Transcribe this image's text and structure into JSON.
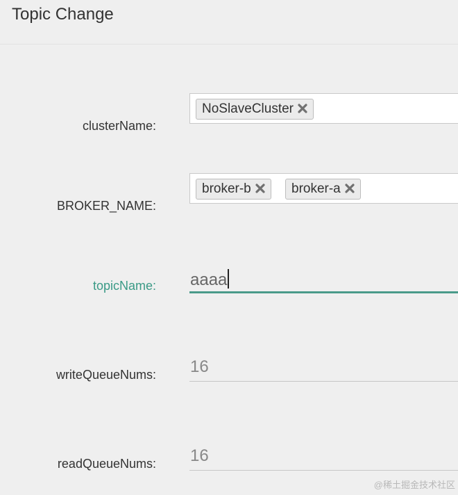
{
  "header": {
    "title": "Topic Change"
  },
  "form": {
    "cluster": {
      "label": "clusterName:",
      "tags": [
        "NoSlaveCluster"
      ]
    },
    "broker": {
      "label": "BROKER_NAME:",
      "tags": [
        "broker-b",
        "broker-a"
      ]
    },
    "topic": {
      "label": "topicName:",
      "value": "aaaa"
    },
    "write_queue": {
      "label": "writeQueueNums:",
      "value": "16"
    },
    "read_queue": {
      "label": "readQueueNums:",
      "value": "16"
    }
  },
  "watermark": "@稀土掘金技术社区",
  "colors": {
    "focus_accent": "#3a9a86",
    "background": "#efefef"
  },
  "icons": {
    "tag_remove": "close-icon"
  }
}
